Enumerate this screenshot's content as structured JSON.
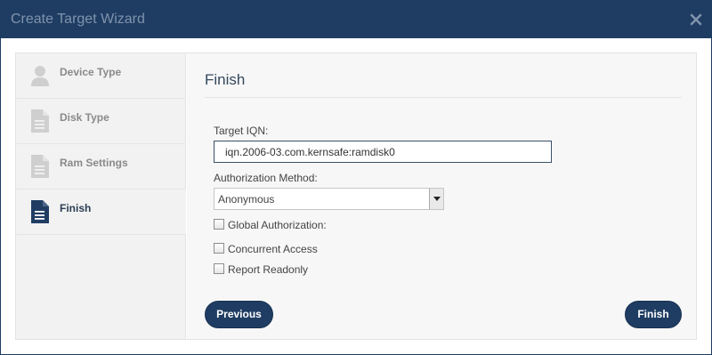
{
  "window": {
    "title": "Create Target Wizard",
    "close_icon": "close-icon"
  },
  "sidebar": {
    "items": [
      {
        "label": "Device Type",
        "icon": "user-icon",
        "active": false
      },
      {
        "label": "Disk Type",
        "icon": "document-icon",
        "active": false
      },
      {
        "label": "Ram Settings",
        "icon": "document-icon",
        "active": false
      },
      {
        "label": "Finish",
        "icon": "document-icon",
        "active": true
      }
    ]
  },
  "main": {
    "section_title": "Finish",
    "target_iqn": {
      "label": "Target IQN:",
      "value": "iqn.2006-03.com.kernsafe:ramdisk0"
    },
    "authorization": {
      "label": "Authorization Method:",
      "selected": "Anonymous"
    },
    "checkboxes": [
      {
        "label": "Global Authorization:",
        "checked": false
      },
      {
        "label": "Concurrent Access",
        "checked": false
      },
      {
        "label": "Report Readonly",
        "checked": false
      }
    ],
    "buttons": {
      "previous": "Previous",
      "finish": "Finish"
    }
  },
  "colors": {
    "header": "#1f3d63",
    "button": "#1f3d63",
    "active_icon": "#1f3d63",
    "inactive_icon": "#cfcfcf"
  }
}
